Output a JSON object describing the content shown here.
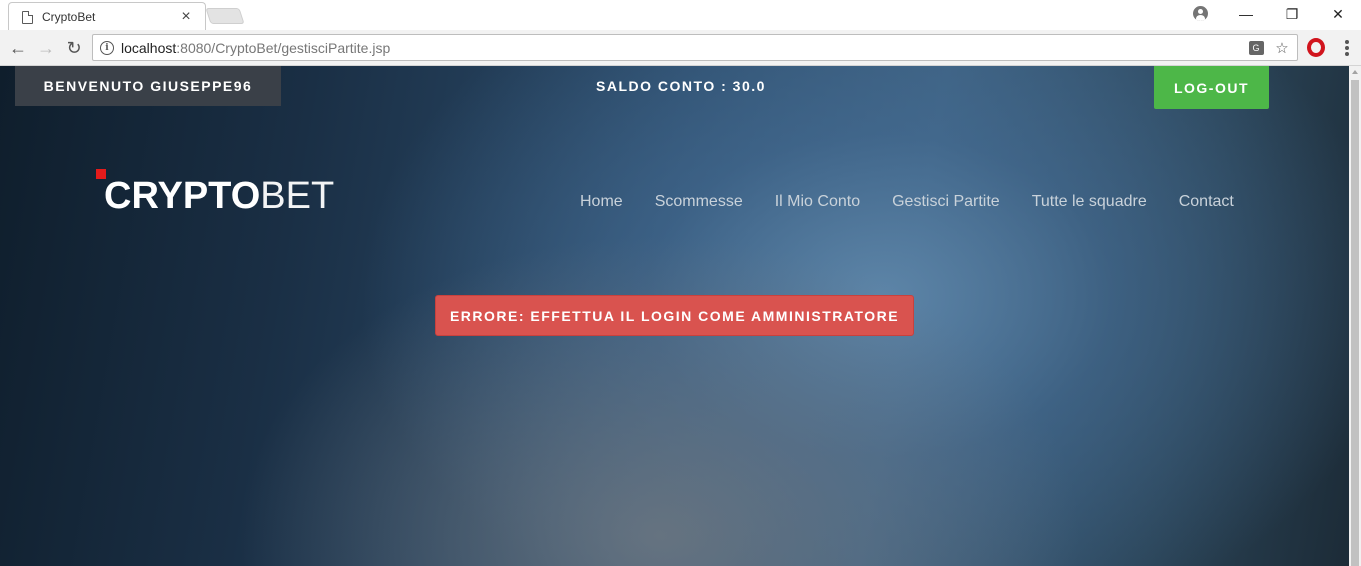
{
  "browser": {
    "tab_title": "CryptoBet",
    "tab_close": "×",
    "url_host": "localhost",
    "url_rest": ":8080/CryptoBet/gestisciPartite.jsp",
    "window_controls": {
      "minimize": "—",
      "restore": "❐",
      "close": "✕"
    },
    "nav": {
      "back": "←",
      "forward": "→",
      "reload": "↻"
    },
    "star": "☆",
    "translate": "G"
  },
  "header": {
    "welcome_label": "BENVENUTO GIUSEPPE96",
    "balance_label": "SALDO CONTO : 30.0",
    "logout_label": "LOG-OUT"
  },
  "logo": {
    "bold": "CRYPTO",
    "light": "BET"
  },
  "nav": {
    "items": [
      "Home",
      "Scommesse",
      "Il Mio Conto",
      "Gestisci Partite",
      "Tutte le squadre",
      "Contact"
    ]
  },
  "alert": {
    "error_label": "ERRORE: EFFETTUA IL LOGIN COME AMMINISTRATORE"
  },
  "colors": {
    "logout_green": "#4db748",
    "error_red": "#d9534f",
    "logo_accent": "#e41b1b",
    "welcome_bg": "#3a4048"
  }
}
